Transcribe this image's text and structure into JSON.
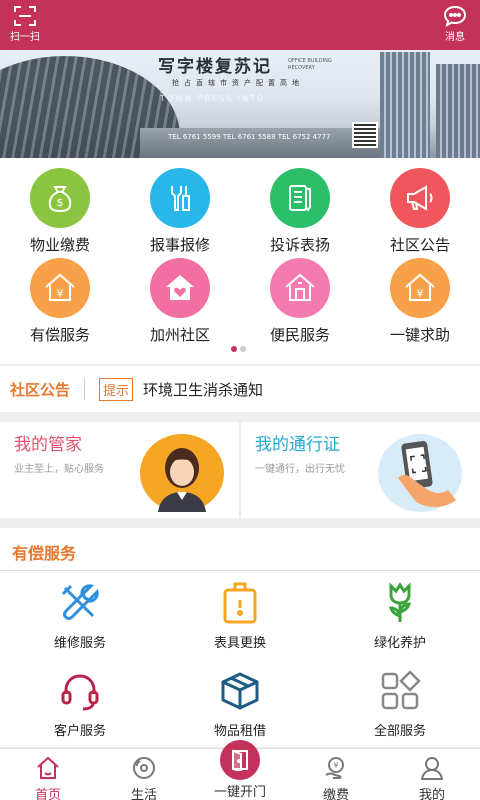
{
  "header": {
    "scan_label": "扫一扫",
    "message_label": "消息",
    "color": "#c4315b"
  },
  "banner": {
    "title": "写字楼复苏记",
    "subtitle_en": "OFFICE BUILDING RECOVERY",
    "subtitle": "抢占直辖市资产配置高地",
    "subtitle_en2": "TOWN PRESS INTO",
    "phones": "TEL 6761 5599    TEL 6761 5588    TEL 6752 4777"
  },
  "menu": {
    "items": [
      {
        "label": "物业缴费",
        "icon": "money-bag-icon",
        "color": "#8bc53f"
      },
      {
        "label": "报事报修",
        "icon": "tools-icon",
        "color": "#29b6e8"
      },
      {
        "label": "投诉表扬",
        "icon": "notebook-icon",
        "color": "#2bbf6a"
      },
      {
        "label": "社区公告",
        "icon": "megaphone-icon",
        "color": "#f0575c"
      },
      {
        "label": "有偿服务",
        "icon": "house-yen-icon",
        "color": "#f6a04a"
      },
      {
        "label": "加州社区",
        "icon": "house-heart-icon",
        "color": "#f26fa2"
      },
      {
        "label": "便民服务",
        "icon": "house-door-icon",
        "color": "#f57ab0"
      },
      {
        "label": "一键求助",
        "icon": "house-help-icon",
        "color": "#f6a04a"
      }
    ],
    "page_count": 2,
    "active_page": 1
  },
  "notice": {
    "title": "社区公告",
    "tag": "提示",
    "text": "环境卫生消杀通知"
  },
  "cards": {
    "left": {
      "title": "我的管家",
      "subtitle": "业主至上，贴心服务",
      "title_color": "#e0526e"
    },
    "right": {
      "title": "我的通行证",
      "subtitle": "一键通行，出行无忧",
      "title_color": "#23a9d6"
    }
  },
  "paid": {
    "title": "有偿服务",
    "items": [
      {
        "label": "维修服务",
        "icon": "wrench-screwdriver-icon"
      },
      {
        "label": "表具更换",
        "icon": "meter-icon"
      },
      {
        "label": "绿化养护",
        "icon": "flower-icon"
      },
      {
        "label": "客户服务",
        "icon": "headset-icon"
      },
      {
        "label": "物品租借",
        "icon": "box-icon"
      },
      {
        "label": "全部服务",
        "icon": "grid-icon"
      }
    ]
  },
  "bottom_nav": {
    "home": "首页",
    "life": "生活",
    "open_door": "一键开门",
    "pay": "缴费",
    "mine": "我的",
    "active": "home"
  }
}
